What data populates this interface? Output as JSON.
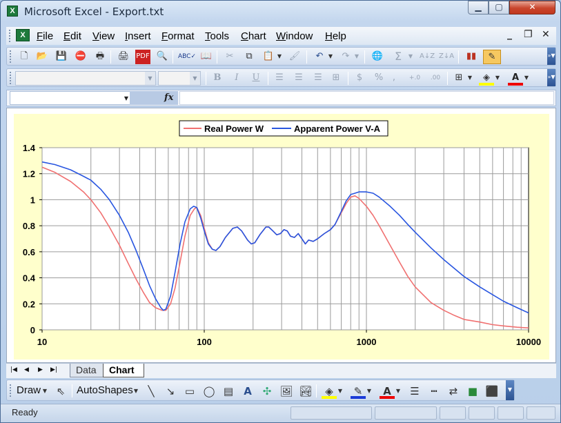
{
  "window": {
    "title": "Microsoft Excel - Export.txt",
    "app_icon": "excel-icon",
    "minimize": "minimize-icon",
    "maximize": "maximize-icon",
    "close": "close-icon"
  },
  "menu": [
    "File",
    "Edit",
    "View",
    "Insert",
    "Format",
    "Tools",
    "Chart",
    "Window",
    "Help"
  ],
  "doc_controls": {
    "minimize": "_",
    "restore": "❐",
    "close": "✕"
  },
  "toolbars": {
    "standard": [
      "new-icon",
      "open-icon",
      "save-icon",
      "permission-icon",
      "print-preview-icon",
      "print-icon",
      "research-icon",
      "spelling-icon",
      "cut-icon",
      "copy-icon",
      "paste-icon",
      "format-painter-icon",
      "undo-icon",
      "redo-icon",
      "hyperlink-icon",
      "autosum-icon",
      "sort-ascending-icon",
      "sort-descending-icon",
      "chart-wizard-icon",
      "drawing-icon"
    ],
    "formatting": {
      "bold": "B",
      "italic": "I",
      "underline": "U",
      "currency": "$",
      "percent": "%",
      "increase_decimal": "+.0",
      "decrease_decimal": ".00"
    }
  },
  "formula_bar": {
    "fx": "fx",
    "name_box": "",
    "content": ""
  },
  "sheet_tabs": [
    "Data",
    "Chart"
  ],
  "active_tab": "Chart",
  "drawing_toolbar": {
    "draw": "Draw",
    "autoshapes": "AutoShapes"
  },
  "status": "Ready",
  "colors": {
    "real_power": "#f07070",
    "apparent_power": "#2855e0",
    "plot_bg": "#ffffff",
    "chart_bg": "#ffffcc"
  },
  "chart_data": {
    "type": "line",
    "x_scale": "log",
    "xlim": [
      10,
      10000
    ],
    "ylim": [
      0,
      1.4
    ],
    "x_ticks": [
      "10",
      "100",
      "1000",
      "10000"
    ],
    "y_ticks": [
      "0",
      "0.2",
      "0.4",
      "0.6",
      "0.8",
      "1",
      "1.2",
      "1.4"
    ],
    "grid": true,
    "legend": "top",
    "series": [
      {
        "name": "Real Power W",
        "color": "#f07070",
        "points": [
          [
            10,
            1.25
          ],
          [
            12,
            1.21
          ],
          [
            15,
            1.14
          ],
          [
            18,
            1.06
          ],
          [
            20,
            1.0
          ],
          [
            23,
            0.9
          ],
          [
            26,
            0.79
          ],
          [
            30,
            0.65
          ],
          [
            34,
            0.51
          ],
          [
            38,
            0.39
          ],
          [
            42,
            0.29
          ],
          [
            46,
            0.21
          ],
          [
            50,
            0.17
          ],
          [
            55,
            0.15
          ],
          [
            58,
            0.15
          ],
          [
            62,
            0.2
          ],
          [
            66,
            0.32
          ],
          [
            71,
            0.52
          ],
          [
            76,
            0.72
          ],
          [
            82,
            0.88
          ],
          [
            87,
            0.93
          ],
          [
            90,
            0.94
          ],
          [
            95,
            0.88
          ],
          [
            100,
            0.78
          ],
          [
            106,
            0.67
          ],
          [
            112,
            0.62
          ],
          [
            118,
            0.61
          ],
          [
            125,
            0.64
          ],
          [
            135,
            0.71
          ],
          [
            150,
            0.78
          ],
          [
            160,
            0.79
          ],
          [
            170,
            0.76
          ],
          [
            185,
            0.69
          ],
          [
            195,
            0.66
          ],
          [
            205,
            0.67
          ],
          [
            220,
            0.73
          ],
          [
            240,
            0.79
          ],
          [
            250,
            0.79
          ],
          [
            265,
            0.76
          ],
          [
            280,
            0.73
          ],
          [
            295,
            0.74
          ],
          [
            310,
            0.77
          ],
          [
            325,
            0.76
          ],
          [
            340,
            0.72
          ],
          [
            360,
            0.71
          ],
          [
            380,
            0.74
          ],
          [
            400,
            0.7
          ],
          [
            420,
            0.66
          ],
          [
            440,
            0.69
          ],
          [
            470,
            0.68
          ],
          [
            500,
            0.7
          ],
          [
            550,
            0.74
          ],
          [
            600,
            0.77
          ],
          [
            640,
            0.81
          ],
          [
            700,
            0.9
          ],
          [
            750,
            0.97
          ],
          [
            800,
            1.02
          ],
          [
            850,
            1.03
          ],
          [
            900,
            1.01
          ],
          [
            1000,
            0.95
          ],
          [
            1100,
            0.88
          ],
          [
            1200,
            0.8
          ],
          [
            1400,
            0.65
          ],
          [
            1600,
            0.52
          ],
          [
            1800,
            0.41
          ],
          [
            2000,
            0.33
          ],
          [
            2500,
            0.21
          ],
          [
            3000,
            0.15
          ],
          [
            3500,
            0.11
          ],
          [
            4000,
            0.08
          ],
          [
            5000,
            0.06
          ],
          [
            6000,
            0.04
          ],
          [
            7000,
            0.03
          ],
          [
            8500,
            0.02
          ],
          [
            10000,
            0.015
          ]
        ]
      },
      {
        "name": "Apparent Power V-A",
        "color": "#2855e0",
        "points": [
          [
            10,
            1.29
          ],
          [
            12,
            1.27
          ],
          [
            15,
            1.23
          ],
          [
            18,
            1.18
          ],
          [
            20,
            1.15
          ],
          [
            23,
            1.08
          ],
          [
            26,
            1.0
          ],
          [
            30,
            0.88
          ],
          [
            34,
            0.75
          ],
          [
            38,
            0.61
          ],
          [
            42,
            0.47
          ],
          [
            46,
            0.34
          ],
          [
            50,
            0.24
          ],
          [
            54,
            0.17
          ],
          [
            56,
            0.15
          ],
          [
            58,
            0.16
          ],
          [
            62,
            0.26
          ],
          [
            66,
            0.44
          ],
          [
            71,
            0.66
          ],
          [
            76,
            0.83
          ],
          [
            82,
            0.93
          ],
          [
            86,
            0.95
          ],
          [
            90,
            0.94
          ],
          [
            95,
            0.86
          ],
          [
            100,
            0.76
          ],
          [
            106,
            0.66
          ],
          [
            112,
            0.62
          ],
          [
            118,
            0.61
          ],
          [
            125,
            0.64
          ],
          [
            135,
            0.71
          ],
          [
            150,
            0.78
          ],
          [
            160,
            0.79
          ],
          [
            170,
            0.76
          ],
          [
            185,
            0.69
          ],
          [
            195,
            0.66
          ],
          [
            205,
            0.67
          ],
          [
            220,
            0.73
          ],
          [
            240,
            0.79
          ],
          [
            250,
            0.79
          ],
          [
            265,
            0.76
          ],
          [
            280,
            0.73
          ],
          [
            295,
            0.74
          ],
          [
            310,
            0.77
          ],
          [
            325,
            0.76
          ],
          [
            340,
            0.72
          ],
          [
            360,
            0.71
          ],
          [
            380,
            0.74
          ],
          [
            400,
            0.7
          ],
          [
            420,
            0.66
          ],
          [
            440,
            0.69
          ],
          [
            470,
            0.68
          ],
          [
            500,
            0.7
          ],
          [
            550,
            0.74
          ],
          [
            600,
            0.77
          ],
          [
            640,
            0.81
          ],
          [
            700,
            0.91
          ],
          [
            750,
            0.99
          ],
          [
            800,
            1.04
          ],
          [
            850,
            1.05
          ],
          [
            900,
            1.06
          ],
          [
            1000,
            1.06
          ],
          [
            1100,
            1.05
          ],
          [
            1200,
            1.02
          ],
          [
            1400,
            0.95
          ],
          [
            1600,
            0.88
          ],
          [
            1800,
            0.81
          ],
          [
            2000,
            0.75
          ],
          [
            2500,
            0.63
          ],
          [
            3000,
            0.54
          ],
          [
            3500,
            0.47
          ],
          [
            4000,
            0.41
          ],
          [
            5000,
            0.33
          ],
          [
            6000,
            0.27
          ],
          [
            7000,
            0.22
          ],
          [
            8500,
            0.17
          ],
          [
            10000,
            0.13
          ]
        ]
      }
    ]
  }
}
